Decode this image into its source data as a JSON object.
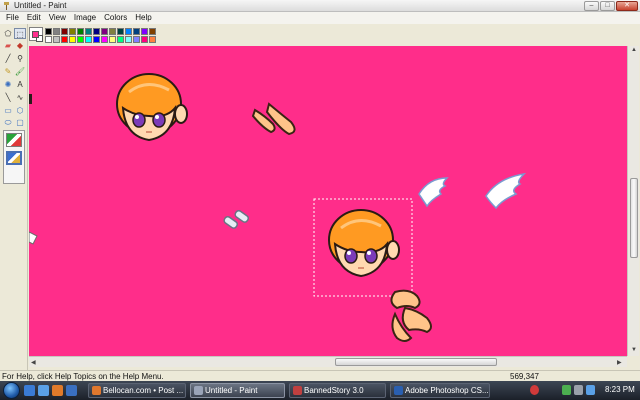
{
  "window": {
    "title": "Untitled - Paint",
    "buttons": {
      "minimize": "–",
      "maximize": "□",
      "close": "✕"
    }
  },
  "menu": [
    "File",
    "Edit",
    "View",
    "Image",
    "Colors",
    "Help"
  ],
  "tools": [
    {
      "name": "free-form-select-tool",
      "glyph": "⬠"
    },
    {
      "name": "select-tool",
      "glyph": "⬚",
      "selected": true
    },
    {
      "name": "eraser-tool",
      "glyph": "▰"
    },
    {
      "name": "fill-tool",
      "glyph": "◆"
    },
    {
      "name": "pick-color-tool",
      "glyph": "╱"
    },
    {
      "name": "magnifier-tool",
      "glyph": "⚲"
    },
    {
      "name": "pencil-tool",
      "glyph": "✎"
    },
    {
      "name": "brush-tool",
      "glyph": "🖌"
    },
    {
      "name": "airbrush-tool",
      "glyph": "✺"
    },
    {
      "name": "text-tool",
      "glyph": "A"
    },
    {
      "name": "line-tool",
      "glyph": "╲"
    },
    {
      "name": "curve-tool",
      "glyph": "∿"
    },
    {
      "name": "rectangle-tool",
      "glyph": "▭"
    },
    {
      "name": "polygon-tool",
      "glyph": "⬡"
    },
    {
      "name": "ellipse-tool",
      "glyph": "⬭"
    },
    {
      "name": "rounded-rectangle-tool",
      "glyph": "▢"
    }
  ],
  "colors": {
    "foreground": "#ff2f8e",
    "background": "#ffffff",
    "canvas": "#ff2d8a",
    "palette": [
      "#000000",
      "#808080",
      "#800000",
      "#808000",
      "#008000",
      "#008080",
      "#000080",
      "#800080",
      "#808040",
      "#004040",
      "#0080ff",
      "#004080",
      "#8000ff",
      "#804000",
      "#ffffff",
      "#c0c0c0",
      "#ff0000",
      "#ffff00",
      "#00ff00",
      "#00ffff",
      "#0000ff",
      "#ff00ff",
      "#ffff80",
      "#00ff80",
      "#80ffff",
      "#8080ff",
      "#ff0080",
      "#ff8040"
    ]
  },
  "status": {
    "help": "For Help, click Help Topics on the Help Menu.",
    "coords": "569,347"
  },
  "taskbar": {
    "items": [
      {
        "label": "Bellocan.com • Post ...",
        "icon_color": "#e0782e"
      },
      {
        "label": "Untitled - Paint",
        "icon_color": "#9aa4b8",
        "active": true
      },
      {
        "label": "BannedStory 3.0",
        "icon_color": "#c04040"
      },
      {
        "label": "Adobe Photoshop CS...",
        "icon_color": "#2a5fb0"
      }
    ],
    "clock": "8:23 PM"
  }
}
